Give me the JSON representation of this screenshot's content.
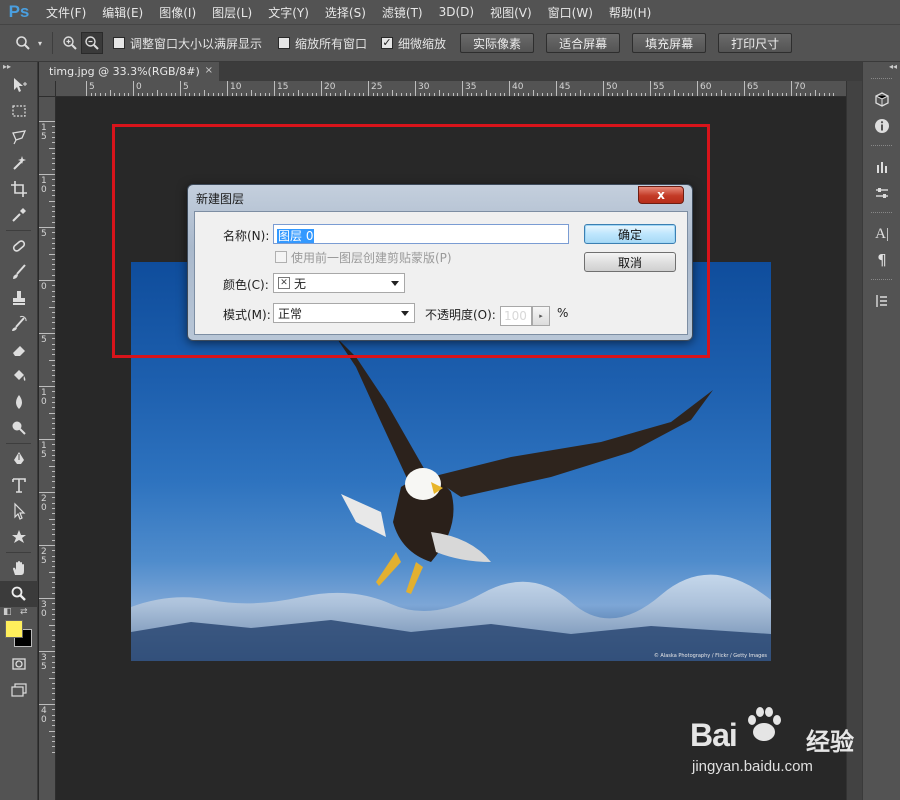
{
  "app": {
    "logo": "Ps"
  },
  "menu": [
    "文件(F)",
    "编辑(E)",
    "图像(I)",
    "图层(L)",
    "文字(Y)",
    "选择(S)",
    "滤镜(T)",
    "3D(D)",
    "视图(V)",
    "窗口(W)",
    "帮助(H)"
  ],
  "options": {
    "checks": [
      {
        "label": "调整窗口大小以满屏显示",
        "checked": false
      },
      {
        "label": "缩放所有窗口",
        "checked": false
      },
      {
        "label": "细微缩放",
        "checked": true
      }
    ],
    "buttons": [
      "实际像素",
      "适合屏幕",
      "填充屏幕",
      "打印尺寸"
    ]
  },
  "document": {
    "tab_title": "timg.jpg @ 33.3%(RGB/8#)",
    "tab_close": "×",
    "photo_credit": "© Alaska Photography / Flickr / Getty Images"
  },
  "ruler": {
    "h_labels": [
      "5",
      "0",
      "5",
      "10",
      "15",
      "20",
      "25",
      "30",
      "35",
      "40",
      "45",
      "50",
      "55",
      "60",
      "65",
      "70"
    ],
    "v_labels": [
      "1\n5",
      "1\n0",
      "5",
      "0",
      "5",
      "1\n0",
      "1\n5",
      "2\n0",
      "2\n5",
      "3\n0",
      "3\n5",
      "4\n0"
    ]
  },
  "dialog": {
    "title": "新建图层",
    "close_glyph": "x",
    "name_label": "名称(N):",
    "name_value": "图层 0",
    "clip_label": "使用前一图层创建剪贴蒙版(P)",
    "color_label": "颜色(C):",
    "color_value": "无",
    "mode_label": "模式(M):",
    "mode_value": "正常",
    "opacity_label": "不透明度(O):",
    "opacity_value": "100",
    "opacity_unit": "%",
    "ok_label": "确定",
    "cancel_label": "取消"
  },
  "watermark": {
    "brand": "Bai",
    "brand_suffix": "经验",
    "url": "jingyan.baidu.com"
  },
  "colors": {
    "foreground": "#ffef5c",
    "background": "#000000",
    "highlight": "#d8141b"
  }
}
